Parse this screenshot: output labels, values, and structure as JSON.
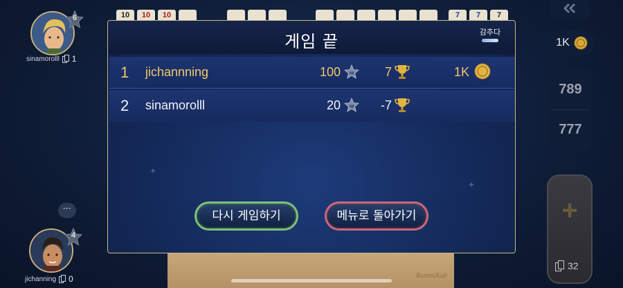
{
  "board": {
    "tiles_left": [
      "10",
      "10",
      "10",
      ""
    ],
    "tiles_mid": [
      "",
      "",
      ""
    ],
    "tiles_mid2": [
      "",
      "",
      "",
      "",
      "",
      "",
      ""
    ],
    "tiles_right": [
      "7",
      "7",
      "7"
    ],
    "brand": "RummiKub"
  },
  "players": [
    {
      "name": "sinamorolll",
      "level": "6",
      "tiles": "1"
    },
    {
      "name": "jichanning",
      "level": "4",
      "tiles": "0"
    }
  ],
  "chat": {
    "label": "···"
  },
  "side": {
    "coins": "1K",
    "scores": [
      "789",
      "777"
    ],
    "pile_count": "32",
    "colors": {
      "panel": "#0f1d36",
      "text": "#9aa2ae"
    }
  },
  "modal": {
    "title": "게임 끝",
    "hide_label": "감추다",
    "results": [
      {
        "rank": "1",
        "name": "jichannning",
        "xp": "100",
        "trophies": "7",
        "coins": "1K"
      },
      {
        "rank": "2",
        "name": "sinamorolll",
        "xp": "20",
        "trophies": "-7",
        "coins": ""
      }
    ],
    "replay_label": "다시 게임하기",
    "menu_label": "메뉴로 돌아가기",
    "colors": {
      "winner": "#f1c96a",
      "replay_border": "#7fc07a",
      "menu_border": "#c86a7a"
    }
  }
}
